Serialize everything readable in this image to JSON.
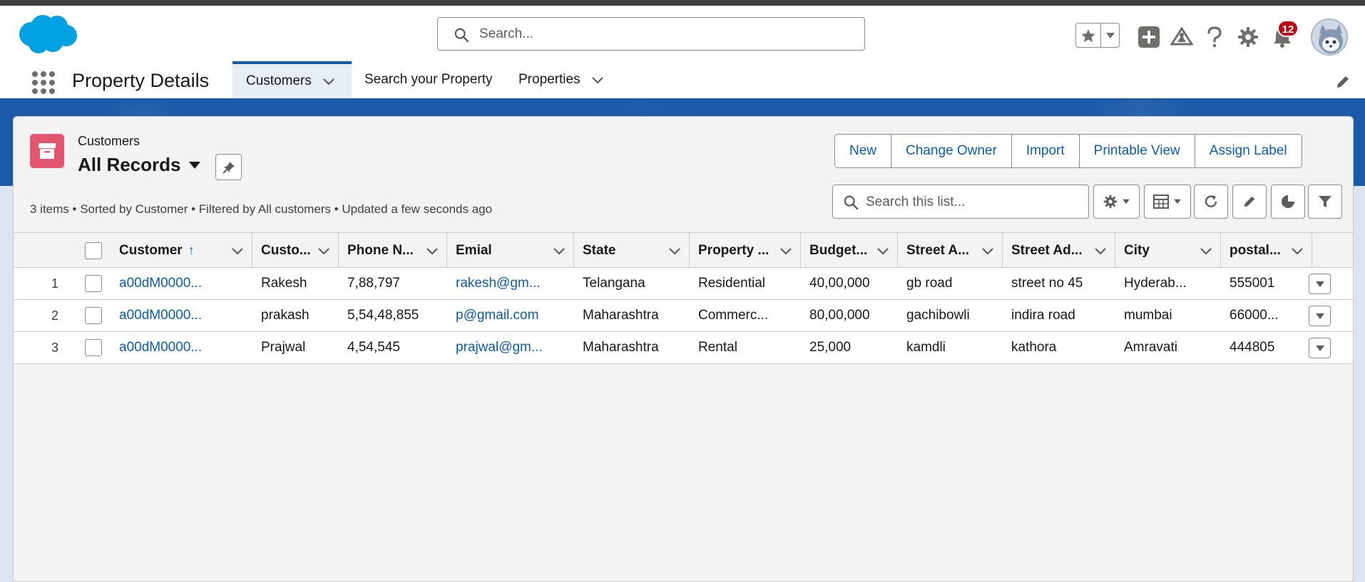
{
  "header": {
    "search_placeholder": "Search...",
    "notification_count": "12"
  },
  "nav": {
    "app_name": "Property Details",
    "tabs": [
      {
        "label": "Customers",
        "active": true,
        "has_menu": true
      },
      {
        "label": "Search your Property",
        "active": false,
        "has_menu": false
      },
      {
        "label": "Properties",
        "active": false,
        "has_menu": true
      }
    ]
  },
  "list_view": {
    "object_label": "Customers",
    "title": "All Records",
    "meta": "3 items • Sorted by Customer • Filtered by All customers • Updated a few seconds ago",
    "actions": [
      "New",
      "Change Owner",
      "Import",
      "Printable View",
      "Assign Label"
    ],
    "search_placeholder": "Search this list..."
  },
  "table": {
    "columns": [
      "Customer",
      "Custo...",
      "Phone N...",
      "Emial",
      "State",
      "Property ...",
      "Budget...",
      "Street A...",
      "Street Ad...",
      "City",
      "postal..."
    ],
    "sorted_column": "Customer",
    "sort_direction": "ascending",
    "rows": [
      {
        "num": "1",
        "cells": [
          "a00dM0000...",
          "Rakesh",
          "7,88,797",
          "rakesh@gm...",
          "Telangana",
          "Residential",
          "40,00,000",
          "gb road",
          "street no 45",
          "Hyderab...",
          "555001"
        ]
      },
      {
        "num": "2",
        "cells": [
          "a00dM0000...",
          "prakash",
          "5,54,48,855",
          "p@gmail.com",
          "Maharashtra",
          "Commerc...",
          "80,00,000",
          "gachibowli",
          "indira road",
          "mumbai",
          "66000..."
        ]
      },
      {
        "num": "3",
        "cells": [
          "a00dM0000...",
          "Prajwal",
          "4,54,545",
          "prajwal@gm...",
          "Maharashtra",
          "Rental",
          "25,000",
          "kamdli",
          "kathora",
          "Amravati",
          "444805"
        ]
      }
    ]
  },
  "colors": {
    "brand_blue": "#0b5cab",
    "band_blue": "#1b5aa8",
    "object_icon": "#e3566f",
    "badge_red": "#ba0517"
  }
}
